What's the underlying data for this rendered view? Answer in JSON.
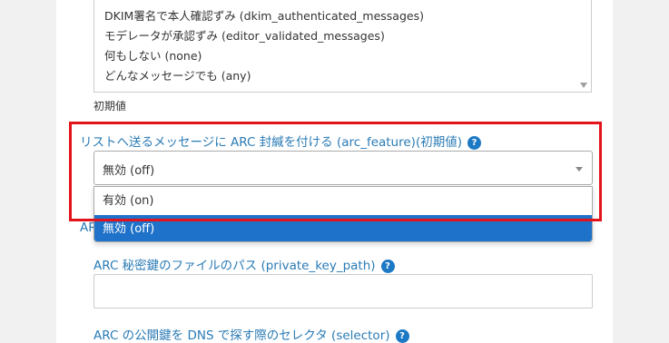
{
  "listbox": {
    "options": [
      "DKIM署名で本人確認ずみ (dkim_authenticated_messages)",
      "モデレータが承認ずみ (editor_validated_messages)",
      "何もしない (none)",
      "どんなメッセージでも (any)"
    ],
    "hint": "初期値"
  },
  "arc_feature": {
    "label": "リストへ送るメッセージに ARC 封緘を付ける (arc_feature)(初期値)",
    "help": "?",
    "selected_value": "無効 (off)",
    "options": [
      "有効 (on)",
      "無効 (off)"
    ],
    "highlighted_option": "無効 (off)"
  },
  "partial_label": "AR",
  "private_key_path": {
    "label": "ARC 秘密鍵のファイルのパス (private_key_path)",
    "help": "?",
    "value": ""
  },
  "selector": {
    "label": "ARC の公開鍵を DNS で探す際のセレクタ (selector)",
    "help": "?"
  },
  "colors": {
    "label_blue": "#2a7bb5",
    "help_icon": "#1d79c4",
    "selected_option": "#1f72c9",
    "highlight_box": "#e3131b"
  }
}
